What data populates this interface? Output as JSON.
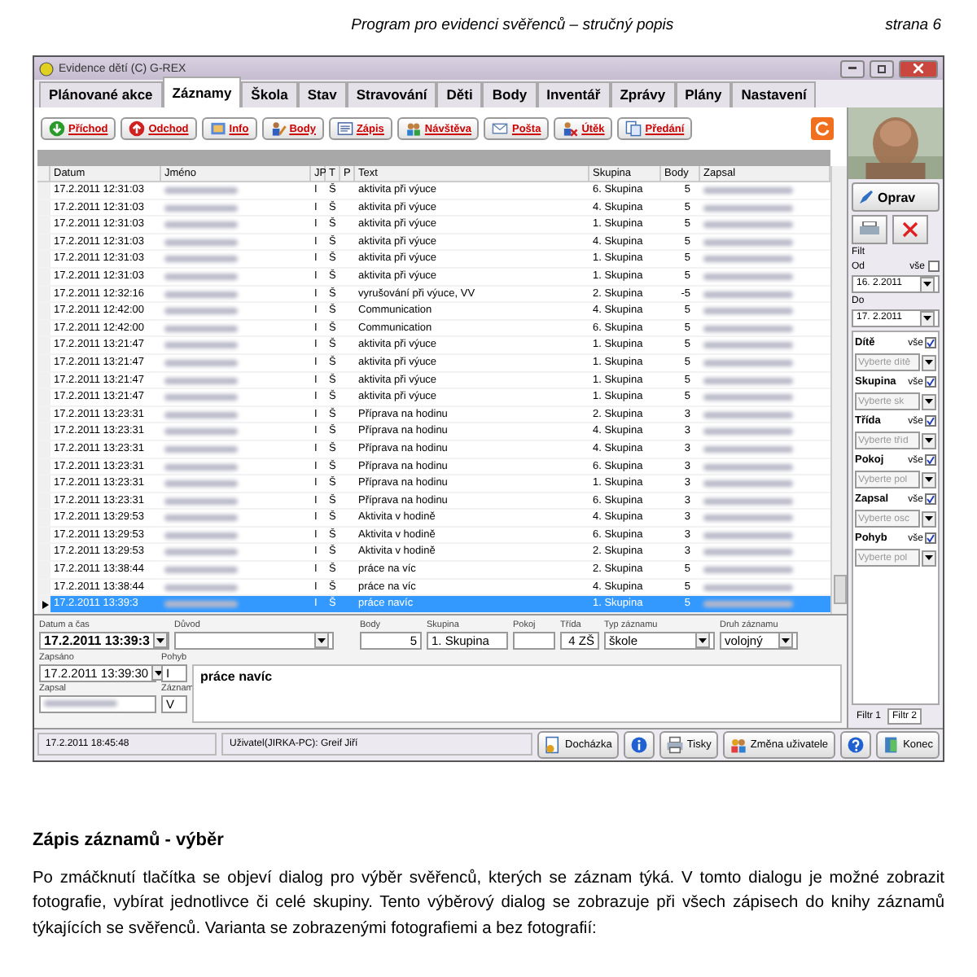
{
  "page_header": {
    "title": "Program pro evidenci svěřenců – stručný popis",
    "page": "strana 6"
  },
  "window": {
    "title": "Evidence dětí (C) G-REX"
  },
  "tabs": [
    {
      "label": "Plánované akce",
      "selected": false
    },
    {
      "label": "Záznamy",
      "selected": true
    },
    {
      "label": "Škola",
      "selected": false
    },
    {
      "label": "Stav",
      "selected": false
    },
    {
      "label": "Stravování",
      "selected": false
    },
    {
      "label": "Děti",
      "selected": false
    },
    {
      "label": "Body",
      "selected": false
    },
    {
      "label": "Inventář",
      "selected": false
    },
    {
      "label": "Zprávy",
      "selected": false
    },
    {
      "label": "Plány",
      "selected": false
    },
    {
      "label": "Nastavení",
      "selected": false
    }
  ],
  "toolbar": [
    "Příchod",
    "Odchod",
    "Info",
    "Body",
    "Zápis",
    "Návštěva",
    "Pošta",
    "Útěk",
    "Předání"
  ],
  "table": {
    "columns": [
      "Datum",
      "Jméno",
      "JP",
      "T",
      "P",
      "Text",
      "Skupina",
      "Body",
      "Zapsal"
    ],
    "rows": [
      {
        "date": "17.2.2011 12:31:03",
        "jp": "I",
        "t": "Š",
        "text": "aktivita při výuce",
        "group": "6. Skupina",
        "points": "5",
        "selected": false
      },
      {
        "date": "17.2.2011 12:31:03",
        "jp": "I",
        "t": "Š",
        "text": "aktivita při výuce",
        "group": "4. Skupina",
        "points": "5",
        "selected": false
      },
      {
        "date": "17.2.2011 12:31:03",
        "jp": "I",
        "t": "Š",
        "text": "aktivita při výuce",
        "group": "1. Skupina",
        "points": "5",
        "selected": false
      },
      {
        "date": "17.2.2011 12:31:03",
        "jp": "I",
        "t": "Š",
        "text": "aktivita při výuce",
        "group": "4. Skupina",
        "points": "5",
        "selected": false
      },
      {
        "date": "17.2.2011 12:31:03",
        "jp": "I",
        "t": "Š",
        "text": "aktivita při výuce",
        "group": "1. Skupina",
        "points": "5",
        "selected": false
      },
      {
        "date": "17.2.2011 12:31:03",
        "jp": "I",
        "t": "Š",
        "text": "aktivita při výuce",
        "group": "1. Skupina",
        "points": "5",
        "selected": false
      },
      {
        "date": "17.2.2011 12:32:16",
        "jp": "I",
        "t": "Š",
        "text": "vyrušování při výuce, VV",
        "group": "2. Skupina",
        "points": "-5",
        "selected": false
      },
      {
        "date": "17.2.2011 12:42:00",
        "jp": "I",
        "t": "Š",
        "text": "Communication",
        "group": "4. Skupina",
        "points": "5",
        "selected": false
      },
      {
        "date": "17.2.2011 12:42:00",
        "jp": "I",
        "t": "Š",
        "text": "Communication",
        "group": "6. Skupina",
        "points": "5",
        "selected": false
      },
      {
        "date": "17.2.2011 13:21:47",
        "jp": "I",
        "t": "Š",
        "text": "aktivita při výuce",
        "group": "1. Skupina",
        "points": "5",
        "selected": false
      },
      {
        "date": "17.2.2011 13:21:47",
        "jp": "I",
        "t": "Š",
        "text": "aktivita při výuce",
        "group": "1. Skupina",
        "points": "5",
        "selected": false
      },
      {
        "date": "17.2.2011 13:21:47",
        "jp": "I",
        "t": "Š",
        "text": "aktivita při výuce",
        "group": "1. Skupina",
        "points": "5",
        "selected": false
      },
      {
        "date": "17.2.2011 13:21:47",
        "jp": "I",
        "t": "Š",
        "text": "aktivita při výuce",
        "group": "1. Skupina",
        "points": "5",
        "selected": false
      },
      {
        "date": "17.2.2011 13:23:31",
        "jp": "I",
        "t": "Š",
        "text": "Příprava na hodinu",
        "group": "2. Skupina",
        "points": "3",
        "selected": false
      },
      {
        "date": "17.2.2011 13:23:31",
        "jp": "I",
        "t": "Š",
        "text": "Příprava na hodinu",
        "group": "4. Skupina",
        "points": "3",
        "selected": false
      },
      {
        "date": "17.2.2011 13:23:31",
        "jp": "I",
        "t": "Š",
        "text": "Příprava na hodinu",
        "group": "4. Skupina",
        "points": "3",
        "selected": false
      },
      {
        "date": "17.2.2011 13:23:31",
        "jp": "I",
        "t": "Š",
        "text": "Příprava na hodinu",
        "group": "6. Skupina",
        "points": "3",
        "selected": false
      },
      {
        "date": "17.2.2011 13:23:31",
        "jp": "I",
        "t": "Š",
        "text": "Příprava na hodinu",
        "group": "1. Skupina",
        "points": "3",
        "selected": false
      },
      {
        "date": "17.2.2011 13:23:31",
        "jp": "I",
        "t": "Š",
        "text": "Příprava na hodinu",
        "group": "6. Skupina",
        "points": "3",
        "selected": false
      },
      {
        "date": "17.2.2011 13:29:53",
        "jp": "I",
        "t": "Š",
        "text": "Aktivita v hodině",
        "group": "4. Skupina",
        "points": "3",
        "selected": false
      },
      {
        "date": "17.2.2011 13:29:53",
        "jp": "I",
        "t": "Š",
        "text": "Aktivita v hodině",
        "group": "6. Skupina",
        "points": "3",
        "selected": false
      },
      {
        "date": "17.2.2011 13:29:53",
        "jp": "I",
        "t": "Š",
        "text": "Aktivita v hodině",
        "group": "2. Skupina",
        "points": "3",
        "selected": false
      },
      {
        "date": "17.2.2011 13:38:44",
        "jp": "I",
        "t": "Š",
        "text": "práce na víc",
        "group": "2. Skupina",
        "points": "5",
        "selected": false
      },
      {
        "date": "17.2.2011 13:38:44",
        "jp": "I",
        "t": "Š",
        "text": "práce na víc",
        "group": "4. Skupina",
        "points": "5",
        "selected": false
      },
      {
        "date": "17.2.2011 13:39:3",
        "jp": "I",
        "t": "Š",
        "text": "práce navíc",
        "group": "1. Skupina",
        "points": "5",
        "selected": true
      }
    ]
  },
  "form": {
    "date_time": {
      "label": "Datum a čas",
      "value": "17.2.2011 13:39:3"
    },
    "reason": {
      "label": "Důvod"
    },
    "points": {
      "label": "Body",
      "value": "5"
    },
    "group": {
      "label": "Skupina",
      "value": "1. Skupina"
    },
    "room": {
      "label": "Pokoj"
    },
    "class": {
      "label": "Třída",
      "value": "4 ZŠ"
    },
    "record_type": {
      "label": "Typ záznamu",
      "value": "škole"
    },
    "record_kind": {
      "label": "Druh záznamu",
      "value": "volojný"
    },
    "written": {
      "label": "Zapsáno",
      "value": "17.2.2011 13:39:30"
    },
    "movement": {
      "label": "Pohyb",
      "value": "I"
    },
    "note": "práce navíc",
    "author": {
      "label": "Zapsal"
    },
    "record": {
      "label": "Záznam",
      "value": "V"
    }
  },
  "side_panel": {
    "edit_button": "Oprav",
    "filter_label": "Filt",
    "from": {
      "label": "Od",
      "all_label": "vše",
      "all_checked": false,
      "value": "16. 2.2011"
    },
    "to": {
      "label": "Do",
      "value": "17. 2.2011"
    },
    "filters": [
      {
        "label": "Dítě",
        "all_label": "vše",
        "checked": true,
        "placeholder": "Vyberte dítě"
      },
      {
        "label": "Skupina",
        "all_label": "vše",
        "checked": true,
        "placeholder": "Vyberte sk"
      },
      {
        "label": "Třída",
        "all_label": "vše",
        "checked": true,
        "placeholder": "Vyberte tříd"
      },
      {
        "label": "Pokoj",
        "all_label": "vše",
        "checked": true,
        "placeholder": "Vyberte pol"
      },
      {
        "label": "Zapsal",
        "all_label": "vše",
        "checked": true,
        "placeholder": "Vyberte osc"
      },
      {
        "label": "Pohyb",
        "all_label": "vše",
        "checked": true,
        "placeholder": "Vyberte pol"
      }
    ],
    "tabs": [
      {
        "label": "Filtr 1",
        "selected": false
      },
      {
        "label": "Filtr 2",
        "selected": true
      }
    ]
  },
  "status_bar": {
    "time": "17.2.2011 18:45:48",
    "user": "Uživatel(JIRKA-PC): Greif Jiří",
    "buttons": [
      {
        "kind": "text",
        "label": "Docházka"
      },
      {
        "kind": "icon"
      },
      {
        "kind": "text",
        "label": "Tisky"
      },
      {
        "kind": "text",
        "label": "Změna uživatele"
      },
      {
        "kind": "icon"
      },
      {
        "kind": "text",
        "label": "Konec"
      }
    ]
  },
  "section": {
    "heading": "Zápis záznamů - výběr",
    "paragraph": "Po zmáčknutí tlačítka se objeví dialog pro výběr svěřenců, kterých se záznam týká. V tomto dialogu je možné zobrazit fotografie, vybírat jednotlivce či celé skupiny. Tento výběrový dialog se zobrazuje při všech zápisech do knihy záznamů týkajících se svěřenců. Varianta se zobrazenými fotografiemi a bez fotografií:"
  }
}
